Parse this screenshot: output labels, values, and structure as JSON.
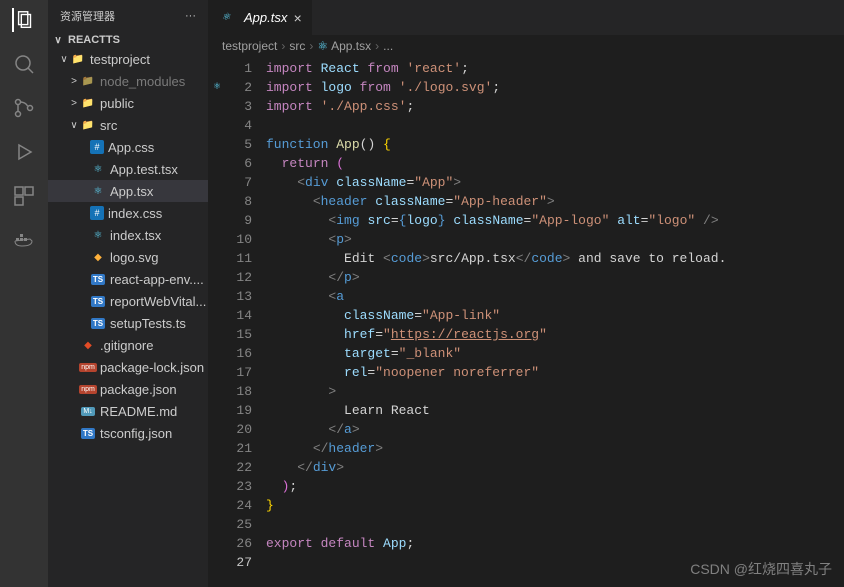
{
  "sidebar": {
    "title": "资源管理器",
    "section": "REACTTS",
    "tree": [
      {
        "indent": 1,
        "chev": "∨",
        "icon": "folder",
        "name": "testproject",
        "dim": false
      },
      {
        "indent": 2,
        "chev": ">",
        "icon": "folder-dim",
        "name": "node_modules",
        "dim": true
      },
      {
        "indent": 2,
        "chev": ">",
        "icon": "folder",
        "name": "public",
        "dim": false
      },
      {
        "indent": 2,
        "chev": "∨",
        "icon": "folder",
        "name": "src",
        "dim": false
      },
      {
        "indent": 3,
        "chev": "",
        "icon": "css",
        "name": "App.css",
        "dim": false
      },
      {
        "indent": 3,
        "chev": "",
        "icon": "react",
        "name": "App.test.tsx",
        "dim": false
      },
      {
        "indent": 3,
        "chev": "",
        "icon": "react",
        "name": "App.tsx",
        "dim": false,
        "selected": true
      },
      {
        "indent": 3,
        "chev": "",
        "icon": "css",
        "name": "index.css",
        "dim": false
      },
      {
        "indent": 3,
        "chev": "",
        "icon": "react",
        "name": "index.tsx",
        "dim": false
      },
      {
        "indent": 3,
        "chev": "",
        "icon": "svg",
        "name": "logo.svg",
        "dim": false
      },
      {
        "indent": 3,
        "chev": "",
        "icon": "ts",
        "name": "react-app-env....",
        "dim": false
      },
      {
        "indent": 3,
        "chev": "",
        "icon": "ts",
        "name": "reportWebVital...",
        "dim": false
      },
      {
        "indent": 3,
        "chev": "",
        "icon": "ts",
        "name": "setupTests.ts",
        "dim": false
      },
      {
        "indent": 2,
        "chev": "",
        "icon": "git",
        "name": ".gitignore",
        "dim": false
      },
      {
        "indent": 2,
        "chev": "",
        "icon": "json",
        "name": "package-lock.json",
        "dim": false
      },
      {
        "indent": 2,
        "chev": "",
        "icon": "json",
        "name": "package.json",
        "dim": false
      },
      {
        "indent": 2,
        "chev": "",
        "icon": "md",
        "name": "README.md",
        "dim": false
      },
      {
        "indent": 2,
        "chev": "",
        "icon": "ts",
        "name": "tsconfig.json",
        "dim": false
      }
    ]
  },
  "tab": {
    "name": "App.tsx",
    "close": "×"
  },
  "breadcrumb": [
    "testproject",
    "src",
    "App.tsx",
    "..."
  ],
  "code_lines": [
    "<span class='kw'>import</span> <span class='ident'>React</span> <span class='kw'>from</span> <span class='str'>'react'</span>;",
    "<span class='kw'>import</span> <span class='ident'>logo</span> <span class='kw'>from</span> <span class='str'>'./logo.svg'</span>;",
    "<span class='kw'>import</span> <span class='str'>'./App.css'</span>;",
    "",
    "<span class='brace'>function</span> <span class='fn'>App</span>() <span class='yellow'>{</span>",
    "  <span class='kw'>return</span> <span class='purple'>(</span>",
    "    <span class='tag'>&lt;</span><span class='tagname'>div</span> <span class='attr'>className</span>=<span class='str'>\"App\"</span><span class='tag'>&gt;</span>",
    "      <span class='tag'>&lt;</span><span class='tagname'>header</span> <span class='attr'>className</span>=<span class='str'>\"App-header\"</span><span class='tag'>&gt;</span>",
    "        <span class='tag'>&lt;</span><span class='tagname'>img</span> <span class='attr'>src</span>=<span class='brace'>{</span><span class='ident'>logo</span><span class='brace'>}</span> <span class='attr'>className</span>=<span class='str'>\"App-logo\"</span> <span class='attr'>alt</span>=<span class='str'>\"logo\"</span> <span class='tag'>/&gt;</span>",
    "        <span class='tag'>&lt;</span><span class='tagname'>p</span><span class='tag'>&gt;</span>",
    "          <span class='plain'>Edit </span><span class='tag'>&lt;</span><span class='tagname'>code</span><span class='tag'>&gt;</span><span class='plain'>src/App.tsx</span><span class='tag'>&lt;/</span><span class='tagname'>code</span><span class='tag'>&gt;</span><span class='plain'> and save to reload.</span>",
    "        <span class='tag'>&lt;/</span><span class='tagname'>p</span><span class='tag'>&gt;</span>",
    "        <span class='tag'>&lt;</span><span class='tagname'>a</span>",
    "          <span class='attr'>className</span>=<span class='str'>\"App-link\"</span>",
    "          <span class='attr'>href</span>=<span class='str'>\"</span><span class='link'>https://reactjs.org</span><span class='str'>\"</span>",
    "          <span class='attr'>target</span>=<span class='str'>\"_blank\"</span>",
    "          <span class='attr'>rel</span>=<span class='str'>\"noopener noreferrer\"</span>",
    "        <span class='tag'>&gt;</span>",
    "          <span class='plain'>Learn React</span>",
    "        <span class='tag'>&lt;/</span><span class='tagname'>a</span><span class='tag'>&gt;</span>",
    "      <span class='tag'>&lt;/</span><span class='tagname'>header</span><span class='tag'>&gt;</span>",
    "    <span class='tag'>&lt;/</span><span class='tagname'>div</span><span class='tag'>&gt;</span>",
    "  <span class='purple'>)</span>;",
    "<span class='yellow'>}</span>",
    "",
    "<span class='kw'>export</span> <span class='kw'>default</span> <span class='ident'>App</span>;",
    ""
  ],
  "line_count": 27,
  "current_line": 27,
  "watermark": "CSDN @红烧四喜丸子"
}
